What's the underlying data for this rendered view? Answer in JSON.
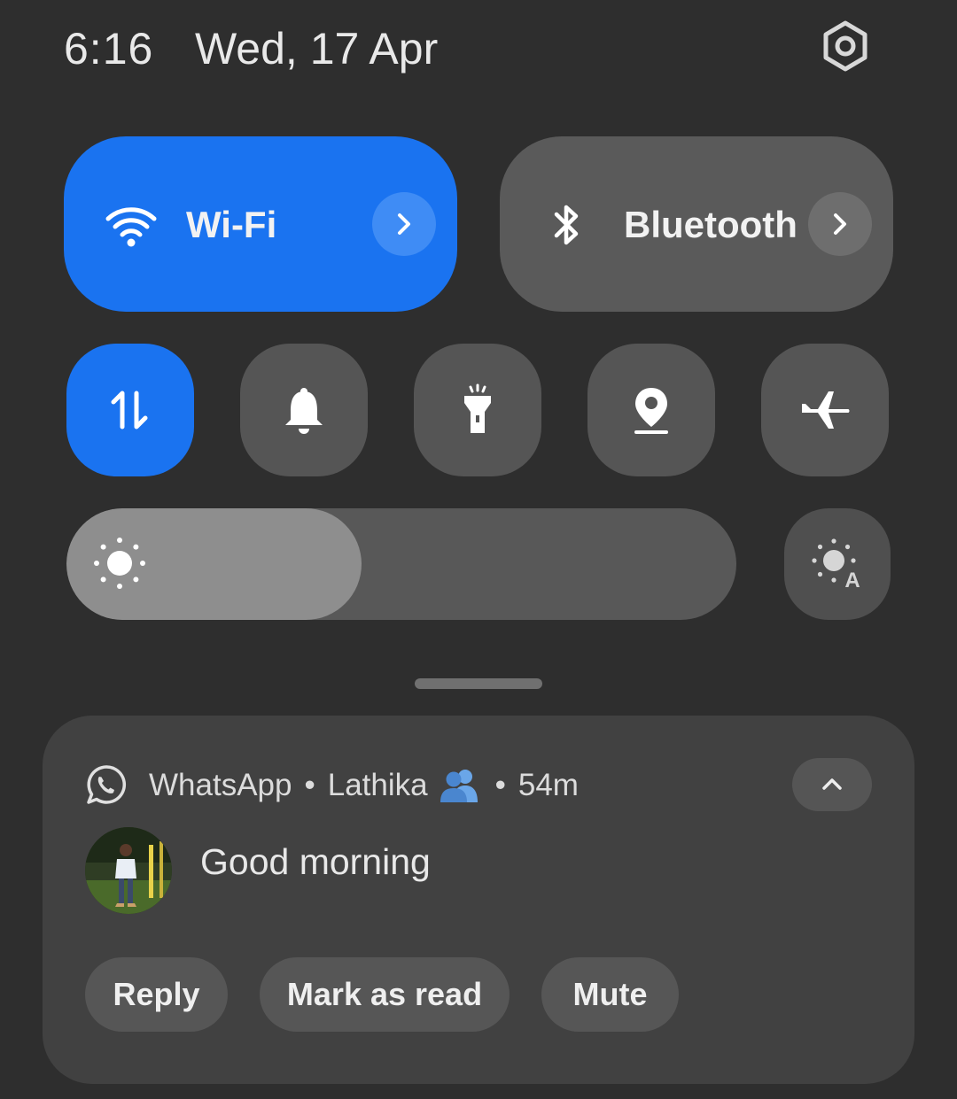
{
  "status": {
    "time": "6:16",
    "date": "Wed, 17 Apr"
  },
  "tiles": {
    "wifi": {
      "label": "Wi-Fi",
      "active": true
    },
    "bluetooth": {
      "label": "Bluetooth",
      "active": false
    },
    "quick": [
      {
        "name": "mobile-data",
        "icon": "data-arrows-icon",
        "active": true
      },
      {
        "name": "sound",
        "icon": "bell-icon",
        "active": false
      },
      {
        "name": "torch",
        "icon": "flashlight-icon",
        "active": false
      },
      {
        "name": "location",
        "icon": "location-pin-icon",
        "active": false
      },
      {
        "name": "airplane-mode",
        "icon": "airplane-icon",
        "active": false
      }
    ]
  },
  "brightness": {
    "level": 0.44,
    "auto_label": "A"
  },
  "notification": {
    "app": "WhatsApp",
    "sender": "Lathika",
    "time_ago": "54m",
    "separator": "•",
    "message": "Good morning",
    "actions": {
      "reply": "Reply",
      "mark_read": "Mark as read",
      "mute": "Mute"
    }
  },
  "colors": {
    "accent": "#1a73f0",
    "tile_inactive": "#555555",
    "panel": "#2e2e2e",
    "card": "#414141"
  }
}
